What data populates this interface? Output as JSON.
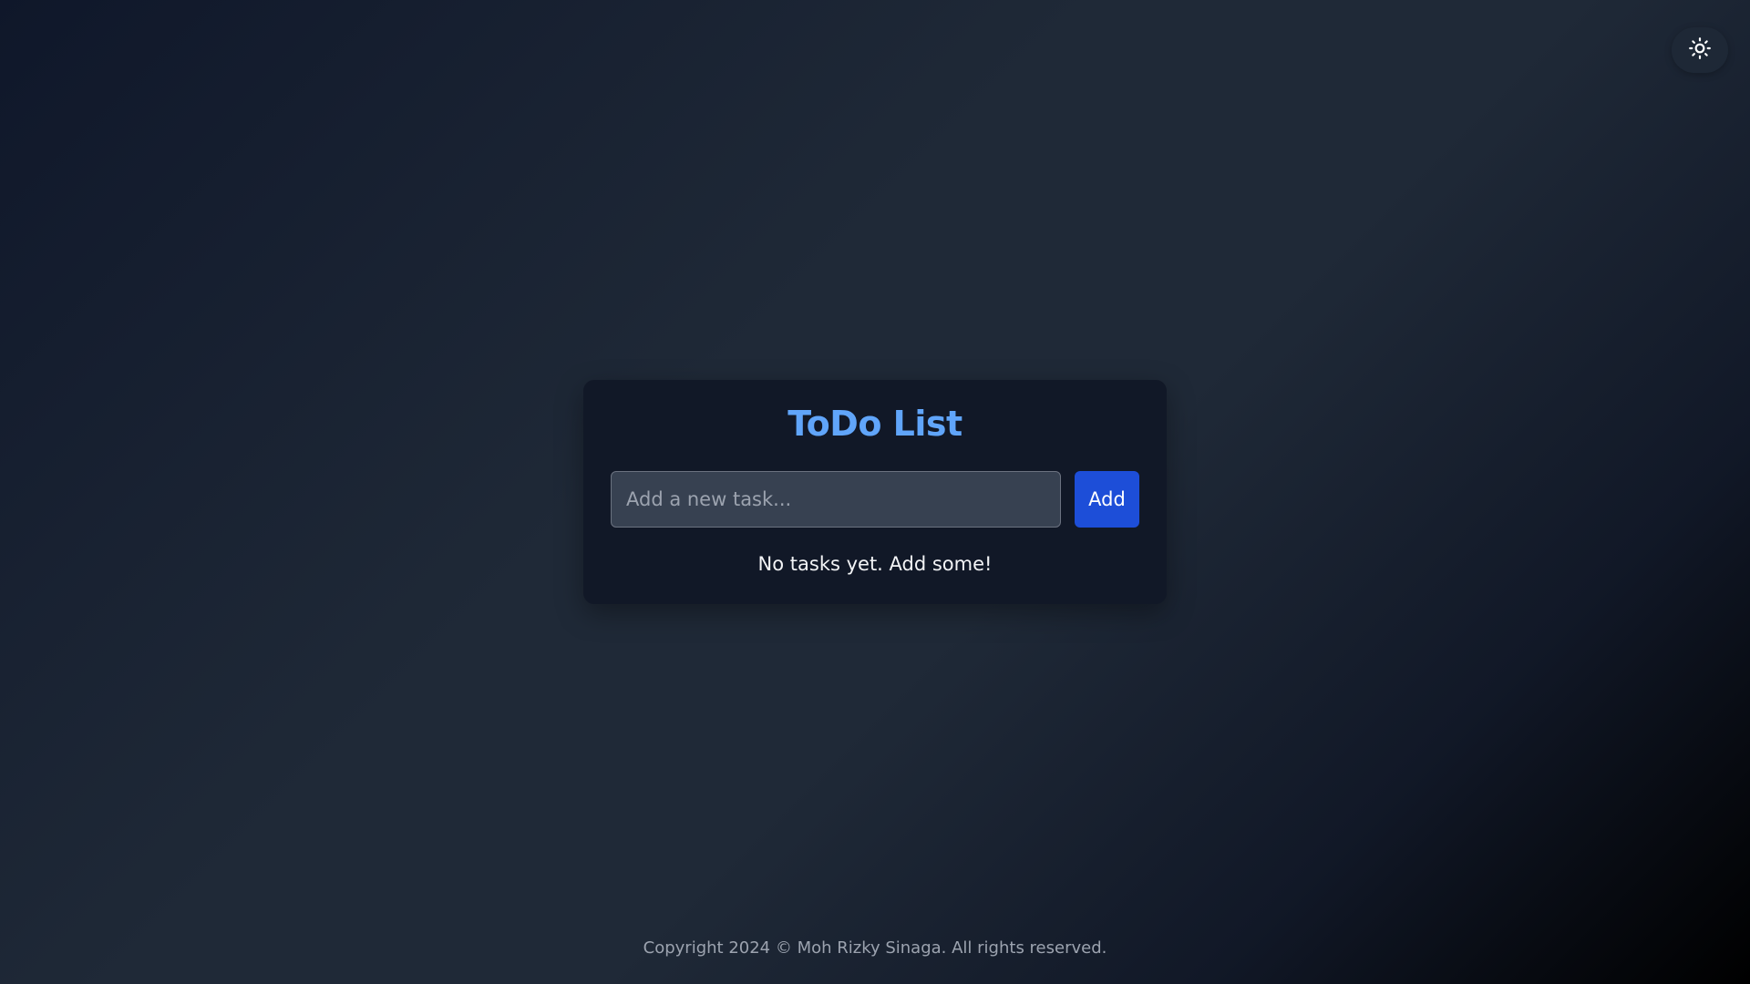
{
  "header": {
    "theme_toggle_icon": "sun-icon"
  },
  "todo": {
    "title": "ToDo List",
    "input_placeholder": "Add a new task...",
    "input_value": "",
    "add_label": "Add",
    "empty_message": "No tasks yet. Add some!"
  },
  "footer": {
    "text": "Copyright 2024 © Moh Rizky Sinaga. All rights reserved."
  },
  "colors": {
    "accent": "#60a5fa",
    "button": "#1d4ed8",
    "card_bg": "#111827"
  }
}
